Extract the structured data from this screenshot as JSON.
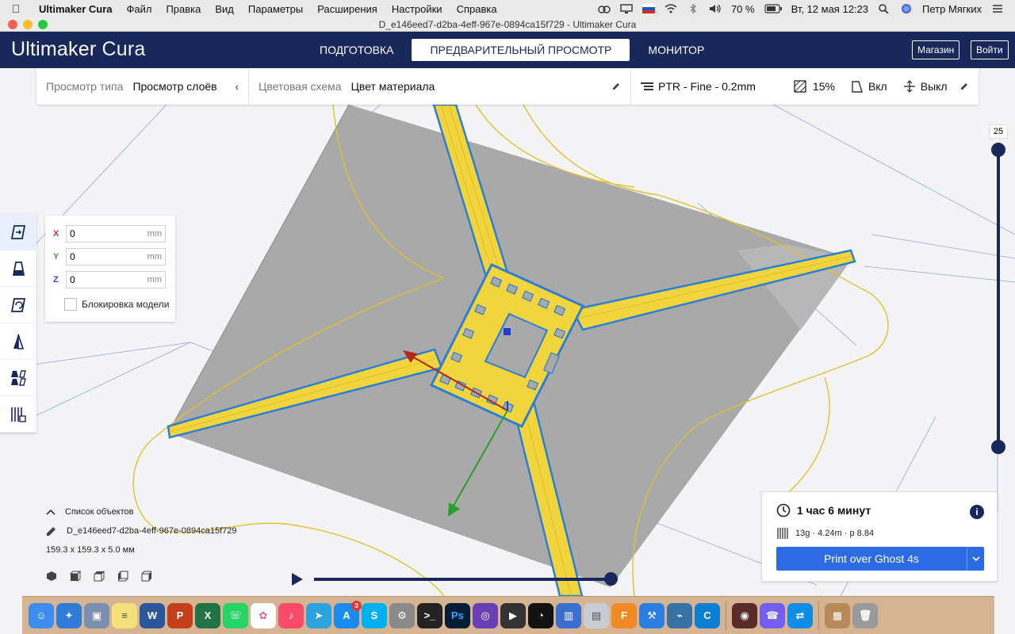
{
  "menubar": {
    "app_name": "Ultimaker Cura",
    "items": [
      "Файл",
      "Правка",
      "Вид",
      "Параметры",
      "Расширения",
      "Настройки",
      "Справка"
    ],
    "battery": "70 %",
    "datetime": "Вт, 12 мая  12:23",
    "user": "Петр Мягких"
  },
  "window": {
    "title": "D_e146eed7-d2ba-4eff-967e-0894ca15f729 - Ultimaker Cura"
  },
  "header": {
    "logo_bold": "Ultimaker",
    "logo_light": "Cura",
    "tabs": [
      {
        "label": "ПОДГОТОВКА",
        "active": false
      },
      {
        "label": "ПРЕДВАРИТЕЛЬНЫЙ ПРОСМОТР",
        "active": true
      },
      {
        "label": "МОНИТОР",
        "active": false
      }
    ],
    "marketplace_label": "Магазин",
    "signin_label": "Войти"
  },
  "viewbar": {
    "view_type_label": "Просмотр типа",
    "view_type_value": "Просмотр слоёв",
    "color_scheme_label": "Цветовая схема",
    "color_scheme_value": "Цвет материала",
    "profile": "PTR - Fine - 0.2mm",
    "infill": "15%",
    "support": "Вкл",
    "adhesion": "Выкл"
  },
  "move_panel": {
    "x_label": "X",
    "x_value": "0",
    "y_label": "Y",
    "y_value": "0",
    "z_label": "Z",
    "z_value": "0",
    "unit": "mm",
    "lock_label": "Блокировка модели"
  },
  "layer_slider": {
    "current_layer": "25"
  },
  "object_list": {
    "header": "Список объектов",
    "object_name": "D_e146eed7-d2ba-4eff-967e-0894ca15f729",
    "dimensions": "159.3 x 159.3 x 5.0 мм"
  },
  "print_panel": {
    "time": "1 час 6 минут",
    "stats": "13g · 4.24m · р 8.84",
    "button_label": "Print over Ghost 4s"
  },
  "dock": {
    "appstore_badge": "3"
  },
  "colors": {
    "header_bg": "#19285a",
    "accent_blue": "#2d6be5",
    "model_yellow": "#f2d53c",
    "outline_blue": "#2b7fd4",
    "build_plate": "#a9a9a9"
  }
}
